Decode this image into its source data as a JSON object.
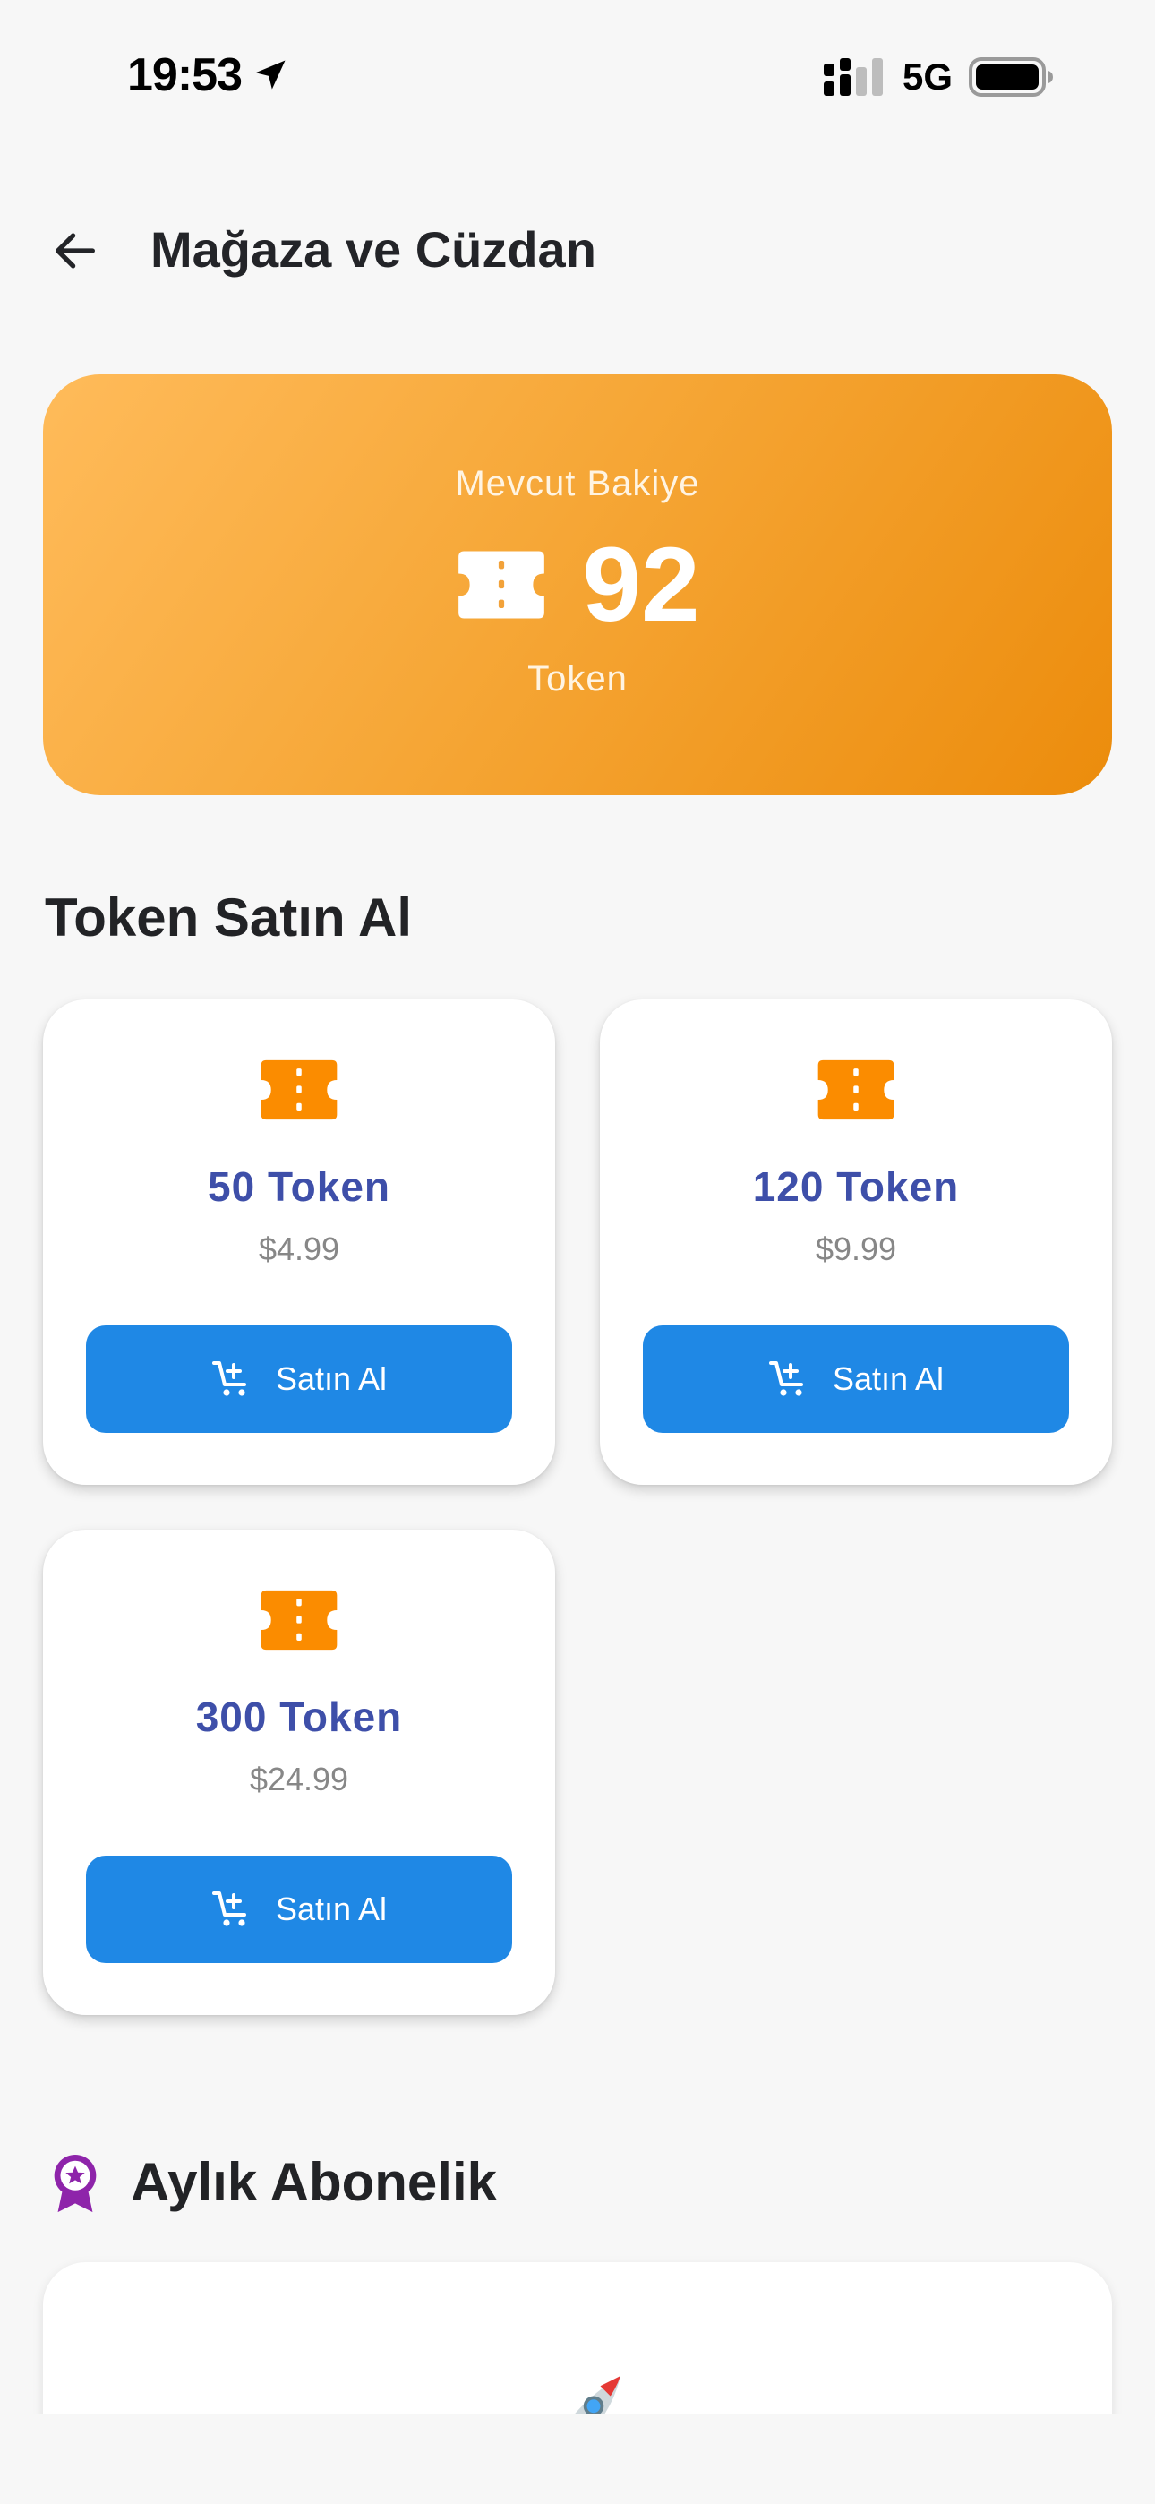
{
  "status_bar": {
    "time": "19:53",
    "network": "5G",
    "icons": [
      "location-arrow-icon",
      "signal-icon",
      "battery-icon"
    ]
  },
  "header": {
    "title": "Mağaza ve Cüzdan",
    "back_icon": "arrow-left-icon"
  },
  "balance": {
    "label": "Mevcut Bakiye",
    "amount": "92",
    "unit": "Token",
    "icon": "ticket-icon"
  },
  "buy_section": {
    "title": "Token Satın Al",
    "packages": [
      {
        "title": "50 Token",
        "price": "$4.99",
        "button_label": "Satın Al"
      },
      {
        "title": "120 Token",
        "price": "$9.99",
        "button_label": "Satın Al"
      },
      {
        "title": "300 Token",
        "price": "$24.99",
        "button_label": "Satın Al"
      }
    ]
  },
  "subscription_section": {
    "title": "Aylık Abonelik",
    "icon": "award-badge-icon",
    "card_icon": "rocket-icon"
  },
  "colors": {
    "background": "#f7f7f7",
    "balance_gradient_start": "#ffbb5a",
    "balance_gradient_end": "#ec8c0c",
    "ticket_orange": "#fb8c00",
    "package_title": "#3e4fa9",
    "buy_button": "#1f88e5",
    "subscription_icon": "#8e24aa"
  }
}
